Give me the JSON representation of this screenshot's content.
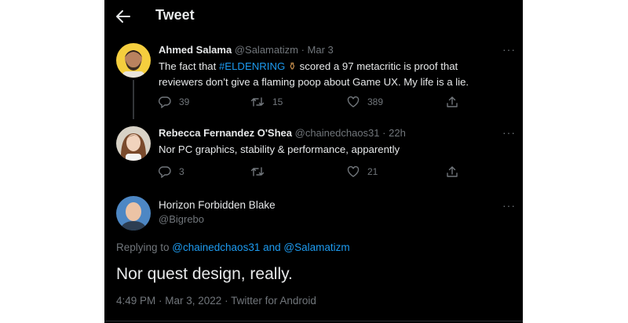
{
  "header": {
    "title": "Tweet"
  },
  "tweets": [
    {
      "display_name": "Ahmed Salama",
      "handle": "@Salamatizm",
      "separator": "·",
      "date": "Mar 3",
      "text_pre": "The fact that ",
      "hashtag": "#ELDENRING",
      "emoji": "⚱",
      "text_post": " scored a 97 metacritic is proof that reviewers don’t give a flaming poop about Game UX. My life is a lie.",
      "replies": "39",
      "retweets": "15",
      "likes": "389",
      "more": "···"
    },
    {
      "display_name": "Rebecca Fernandez O'Shea",
      "handle": "@chainedchaos31",
      "separator": "·",
      "date": "22h",
      "text": "Nor PC graphics, stability & performance, apparently",
      "replies": "3",
      "retweets": "",
      "likes": "21",
      "more": "···"
    }
  ],
  "main": {
    "display_name": "Horizon Forbidden Blake",
    "handle": "@Bigrebo",
    "more": "···",
    "replying_prefix": "Replying to ",
    "replying_to_1": "@chainedchaos31",
    "replying_and": " and ",
    "replying_to_2": "@Salamatizm",
    "text": "Nor quest design, really.",
    "time": "4:49 PM · Mar 3, 2022 · Twitter for Android"
  },
  "icons": [
    "back-arrow-icon",
    "reply-icon",
    "retweet-icon",
    "like-icon",
    "share-icon",
    "more-icon"
  ],
  "colors": {
    "background": "#000000",
    "text": "#e7e9ea",
    "muted": "#71767b",
    "link": "#1d9bf0"
  }
}
